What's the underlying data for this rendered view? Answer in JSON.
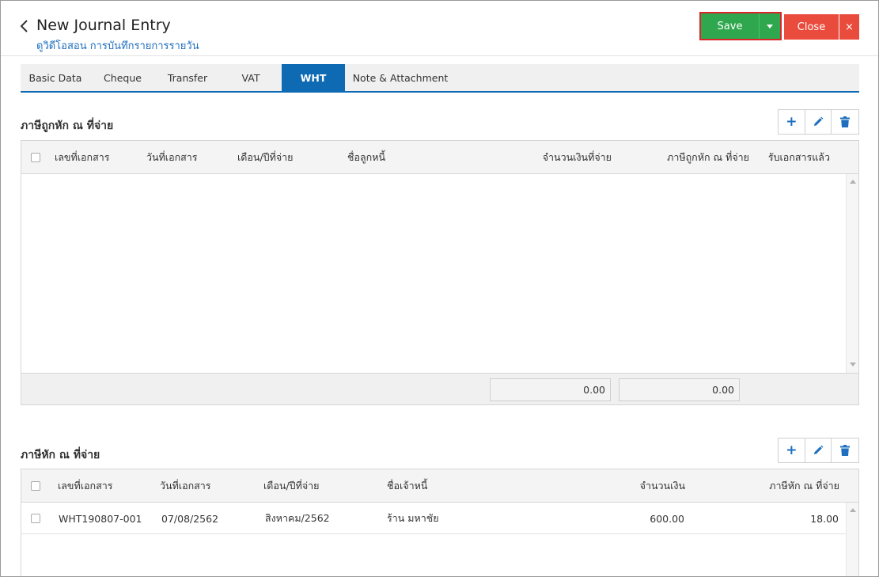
{
  "header": {
    "title": "New Journal Entry",
    "subtitle": "ดูวิดีโอสอน การบันทึกรายการรายวัน",
    "save_label": "Save",
    "close_label": "Close",
    "x_label": "×"
  },
  "tabs": [
    {
      "label": "Basic Data",
      "active": false
    },
    {
      "label": "Cheque",
      "active": false
    },
    {
      "label": "Transfer",
      "active": false
    },
    {
      "label": "VAT",
      "active": false
    },
    {
      "label": "WHT",
      "active": true
    },
    {
      "label": "Note & Attachment",
      "active": false
    }
  ],
  "section1": {
    "title": "ภาษีถูกหัก ณ ที่จ่าย",
    "columns": [
      "เลขที่เอกสาร",
      "วันที่เอกสาร",
      "เดือน/ปีที่จ่าย",
      "ชื่อลูกหนี้",
      "จำนวนเงินที่จ่าย",
      "ภาษีถูกหัก ณ ที่จ่าย",
      "รับเอกสารแล้ว"
    ],
    "total_amount": "0.00",
    "total_tax": "0.00"
  },
  "section2": {
    "title": "ภาษีหัก ณ ที่จ่าย",
    "columns": [
      "เลขที่เอกสาร",
      "วันที่เอกสาร",
      "เดือน/ปีที่จ่าย",
      "ชื่อเจ้าหนี้",
      "จำนวนเงิน",
      "ภาษีหัก ณ ที่จ่าย"
    ],
    "rows": [
      {
        "doc_no": "WHT190807-001",
        "doc_date": "07/08/2562",
        "month_year": "สิงหาคม/2562",
        "creditor": "ร้าน มหาชัย",
        "amount": "600.00",
        "tax": "18.00"
      }
    ]
  },
  "colors": {
    "save": "#2fa74e",
    "close": "#e94b3c",
    "tab_active": "#0d6ab3",
    "link": "#1e6fbf",
    "highlight": "#d9262c"
  }
}
